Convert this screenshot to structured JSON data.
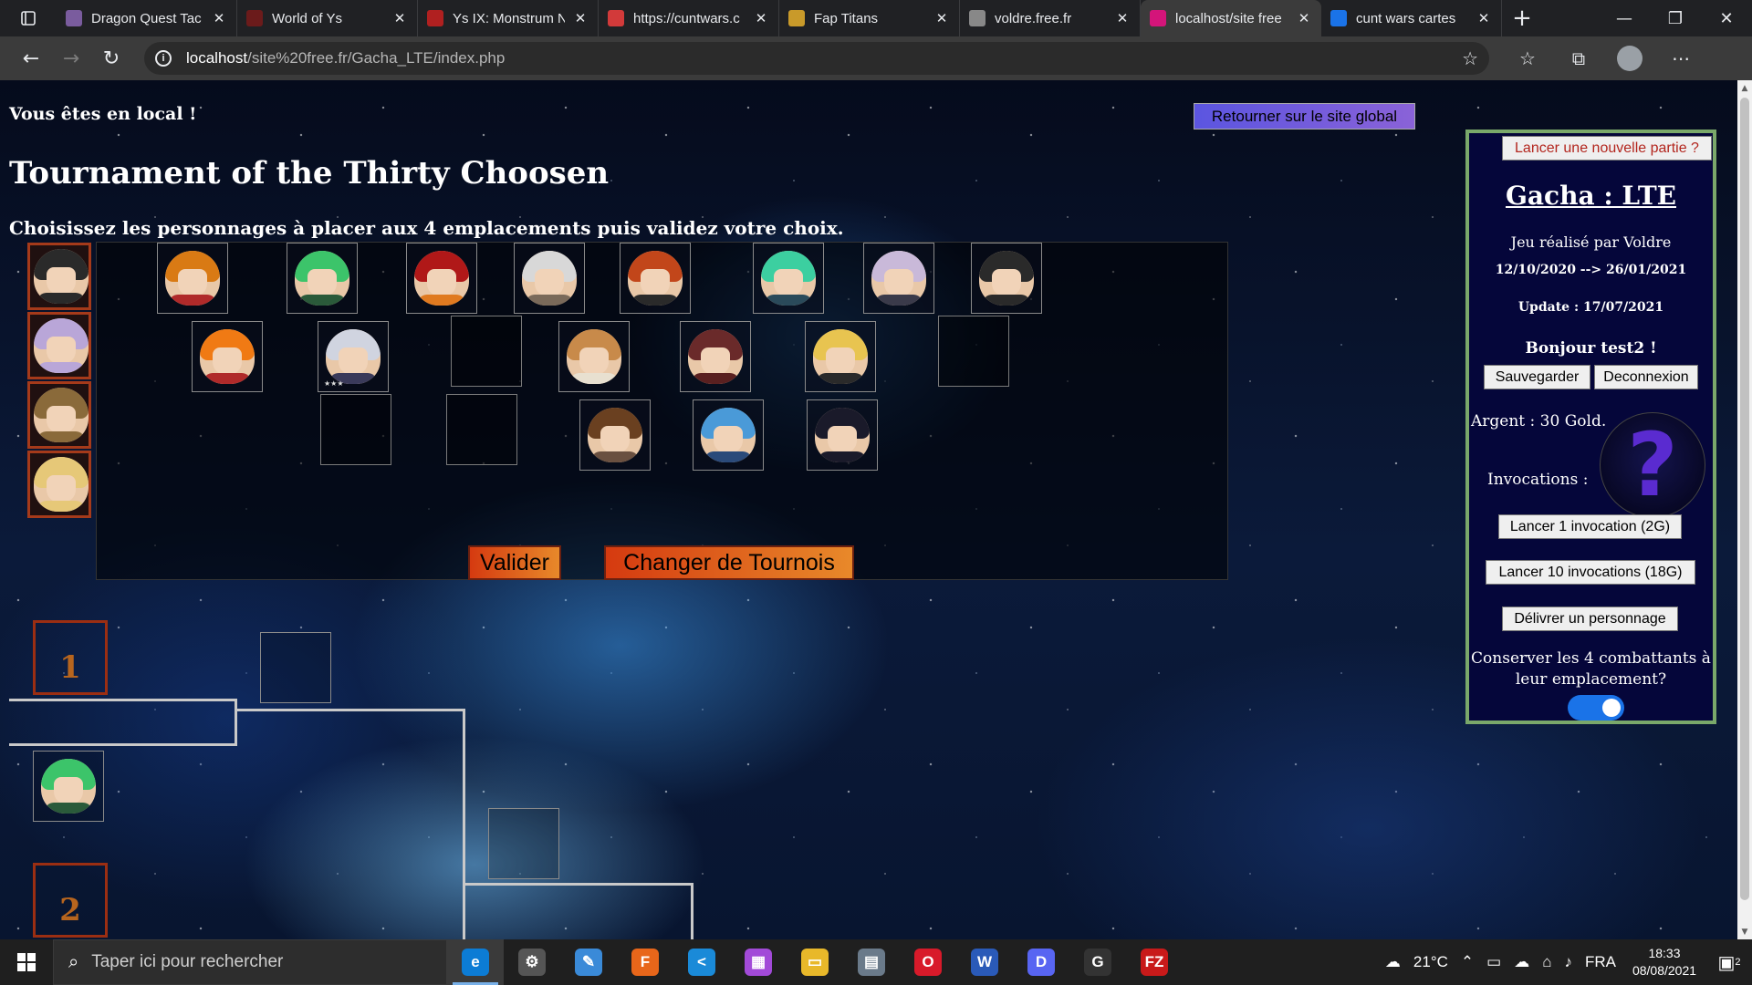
{
  "browser": {
    "tabs": [
      {
        "title": "Dragon Quest Tac",
        "icon_color": "#7a5c9e",
        "active": false
      },
      {
        "title": "World of Ys",
        "icon_color": "#6b1b1b",
        "active": false
      },
      {
        "title": "Ys IX: Monstrum N",
        "icon_color": "#b02020",
        "active": false
      },
      {
        "title": "https://cuntwars.c",
        "icon_color": "#d23a3a",
        "active": false
      },
      {
        "title": "Fap Titans",
        "icon_color": "#c99a2a",
        "active": false
      },
      {
        "title": "voldre.free.fr",
        "icon_color": "#888888",
        "active": false
      },
      {
        "title": "localhost/site free",
        "icon_color": "#d4157a",
        "active": true
      },
      {
        "title": "cunt wars cartes",
        "icon_color": "#1a73e8",
        "active": false
      }
    ],
    "url_host": "localhost",
    "url_path": "/site%20free.fr/Gacha_LTE/index.php"
  },
  "page": {
    "local_msg": "Vous êtes en local !",
    "title": "Tournament of the Thirty Choosen",
    "instructions": "Choisissez les personnages à placer aux 4 emplacements puis validez votre choix.",
    "global_button": "Retourner sur le site global",
    "validate_button": "Valider",
    "change_button": "Changer de Tournois",
    "slot_colors": [
      "#2a2a2a",
      "#b9a6d8",
      "#8a6a3a",
      "#e6c878"
    ],
    "roster": [
      {
        "hair": "#d97a14",
        "body": "#b02a2a",
        "stars": ""
      },
      {
        "hair": "#3cc46a",
        "body": "#2a5a3a",
        "stars": ""
      },
      {
        "hair": "#b01818",
        "body": "#e07a20",
        "stars": ""
      },
      {
        "hair": "#d8d8d8",
        "body": "#7a6a5a",
        "stars": ""
      },
      {
        "hair": "#c2461a",
        "body": "#2a2a2a",
        "stars": ""
      },
      {
        "hair": "#3ccfa0",
        "body": "#2a4a5a",
        "stars": ""
      },
      {
        "hair": "#c9b9d9",
        "body": "#3a3a4a",
        "stars": ""
      },
      {
        "hair": "#2a2a2a",
        "body": "#2a2a2a",
        "stars": ""
      },
      {
        "hair": "#f07a14",
        "body": "#b02a2a",
        "stars": ""
      },
      {
        "hair": "#d0d4e0",
        "body": "#3a3a5a",
        "stars": "★★★"
      },
      {
        "hair": "#c88a4a",
        "body": "#e8e0d0",
        "stars": ""
      },
      {
        "hair": "#6a2a2a",
        "body": "#5a2020",
        "stars": ""
      },
      {
        "hair": "#e8c450",
        "body": "#2a2a2a",
        "stars": ""
      },
      {
        "hair": "#6a4020",
        "body": "#6a5040",
        "stars": ""
      },
      {
        "hair": "#4a9ad8",
        "body": "#2a4a7a",
        "stars": ""
      },
      {
        "hair": "#1a1a2a",
        "body": "#1a1a2a",
        "stars": ""
      }
    ],
    "seeds": [
      "1",
      "2"
    ],
    "bracket_char": {
      "hair": "#3cc46a",
      "body": "#2a5a3a"
    }
  },
  "panel": {
    "new_game": "Lancer une nouvelle partie ?",
    "title": "Gacha : LTE",
    "author": "Jeu réalisé par Voldre",
    "dates": "12/10/2020 --> 26/01/2021",
    "update": "Update : 17/07/2021",
    "greeting": "Bonjour test2 !",
    "save": "Sauvegarder",
    "logout": "Deconnexion",
    "money": "Argent : 30 Gold.",
    "invocations": "Invocations :",
    "invoke_1": "Lancer 1 invocation (2G)",
    "invoke_10": "Lancer 10 invocations (18G)",
    "deliver": "Délivrer un personnage",
    "keep_label": "Conserver les 4 combattants à leur emplacement?",
    "keep_enabled": true,
    "question_glyph": "?"
  },
  "taskbar": {
    "search_placeholder": "Taper ici pour rechercher",
    "apps": [
      {
        "name": "edge",
        "glyph": "e",
        "color": "#0c7cd5",
        "active": true
      },
      {
        "name": "app-2",
        "glyph": "⚙",
        "color": "#555555",
        "active": false
      },
      {
        "name": "paint",
        "glyph": "✎",
        "color": "#3a8ad8",
        "active": false
      },
      {
        "name": "firefox",
        "glyph": "F",
        "color": "#e8661a",
        "active": false
      },
      {
        "name": "vscode",
        "glyph": "<",
        "color": "#1a8ad8",
        "active": false
      },
      {
        "name": "color-app",
        "glyph": "▦",
        "color": "#a24ad8",
        "active": false
      },
      {
        "name": "file-explorer",
        "glyph": "▭",
        "color": "#e8b82a",
        "active": false
      },
      {
        "name": "app-8",
        "glyph": "▤",
        "color": "#6a7a8a",
        "active": false
      },
      {
        "name": "opera",
        "glyph": "O",
        "color": "#d81a2a",
        "active": false
      },
      {
        "name": "word",
        "glyph": "W",
        "color": "#2a5ab8",
        "active": false
      },
      {
        "name": "discord",
        "glyph": "D",
        "color": "#5865f2",
        "active": false
      },
      {
        "name": "github",
        "glyph": "G",
        "color": "#333333",
        "active": false
      },
      {
        "name": "filezilla",
        "glyph": "FZ",
        "color": "#c81a1a",
        "active": false
      }
    ],
    "temperature": "21°C",
    "language": "FRA",
    "time": "18:33",
    "date": "08/08/2021",
    "notifications": "2"
  }
}
